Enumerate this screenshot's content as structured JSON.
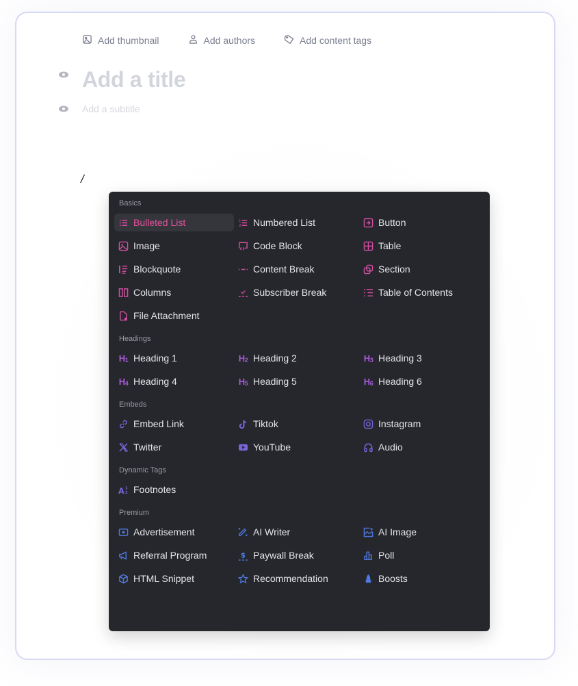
{
  "meta_bar": {
    "thumbnail": "Add thumbnail",
    "authors": "Add authors",
    "tags": "Add content tags"
  },
  "editor": {
    "title_placeholder": "Add a title",
    "subtitle_placeholder": "Add a subtitle",
    "typed_text": "/"
  },
  "colors": {
    "pink": "#d54ea3",
    "purple": "#a55ad6",
    "violet": "#7a63d9",
    "blue": "#4f79e0",
    "active_text": "#e7529d",
    "menu_bg": "#25272c"
  },
  "menu": {
    "sections": [
      {
        "label": "Basics",
        "items": [
          {
            "label": "Bulleted List",
            "icon": "bulleted-list-icon",
            "active": true
          },
          {
            "label": "Numbered List",
            "icon": "numbered-list-icon"
          },
          {
            "label": "Button",
            "icon": "button-icon"
          },
          {
            "label": "Image",
            "icon": "image-icon"
          },
          {
            "label": "Code Block",
            "icon": "code-block-icon"
          },
          {
            "label": "Table",
            "icon": "table-icon"
          },
          {
            "label": "Blockquote",
            "icon": "blockquote-icon"
          },
          {
            "label": "Content Break",
            "icon": "content-break-icon"
          },
          {
            "label": "Section",
            "icon": "section-icon"
          },
          {
            "label": "Columns",
            "icon": "columns-icon"
          },
          {
            "label": "Subscriber Break",
            "icon": "subscriber-break-icon"
          },
          {
            "label": "Table of Contents",
            "icon": "table-of-contents-icon"
          },
          {
            "label": "File Attachment",
            "icon": "file-attachment-icon"
          }
        ]
      },
      {
        "label": "Headings",
        "items": [
          {
            "label": "Heading 1",
            "icon": "heading-1-icon",
            "glyph": "H",
            "sub": "1"
          },
          {
            "label": "Heading 2",
            "icon": "heading-2-icon",
            "glyph": "H",
            "sub": "2"
          },
          {
            "label": "Heading 3",
            "icon": "heading-3-icon",
            "glyph": "H",
            "sub": "3"
          },
          {
            "label": "Heading 4",
            "icon": "heading-4-icon",
            "glyph": "H",
            "sub": "4"
          },
          {
            "label": "Heading 5",
            "icon": "heading-5-icon",
            "glyph": "H",
            "sub": "5"
          },
          {
            "label": "Heading 6",
            "icon": "heading-6-icon",
            "glyph": "H",
            "sub": "6"
          }
        ]
      },
      {
        "label": "Embeds",
        "items": [
          {
            "label": "Embed Link",
            "icon": "link-icon"
          },
          {
            "label": "Tiktok",
            "icon": "tiktok-icon"
          },
          {
            "label": "Instagram",
            "icon": "instagram-icon"
          },
          {
            "label": "Twitter",
            "icon": "x-twitter-icon"
          },
          {
            "label": "YouTube",
            "icon": "youtube-icon"
          },
          {
            "label": "Audio",
            "icon": "headphones-icon"
          }
        ]
      },
      {
        "label": "Dynamic Tags",
        "items": [
          {
            "label": "Footnotes",
            "icon": "footnotes-icon"
          }
        ]
      },
      {
        "label": "Premium",
        "items": [
          {
            "label": "Advertisement",
            "icon": "advertisement-icon"
          },
          {
            "label": "AI Writer",
            "icon": "ai-writer-icon"
          },
          {
            "label": "AI Image",
            "icon": "ai-image-icon"
          },
          {
            "label": "Referral Program",
            "icon": "megaphone-icon"
          },
          {
            "label": "Paywall Break",
            "icon": "paywall-break-icon"
          },
          {
            "label": "Poll",
            "icon": "poll-icon"
          },
          {
            "label": "HTML Snippet",
            "icon": "cube-icon"
          },
          {
            "label": "Recommendation",
            "icon": "star-icon"
          },
          {
            "label": "Boosts",
            "icon": "rocket-icon"
          }
        ]
      }
    ]
  }
}
